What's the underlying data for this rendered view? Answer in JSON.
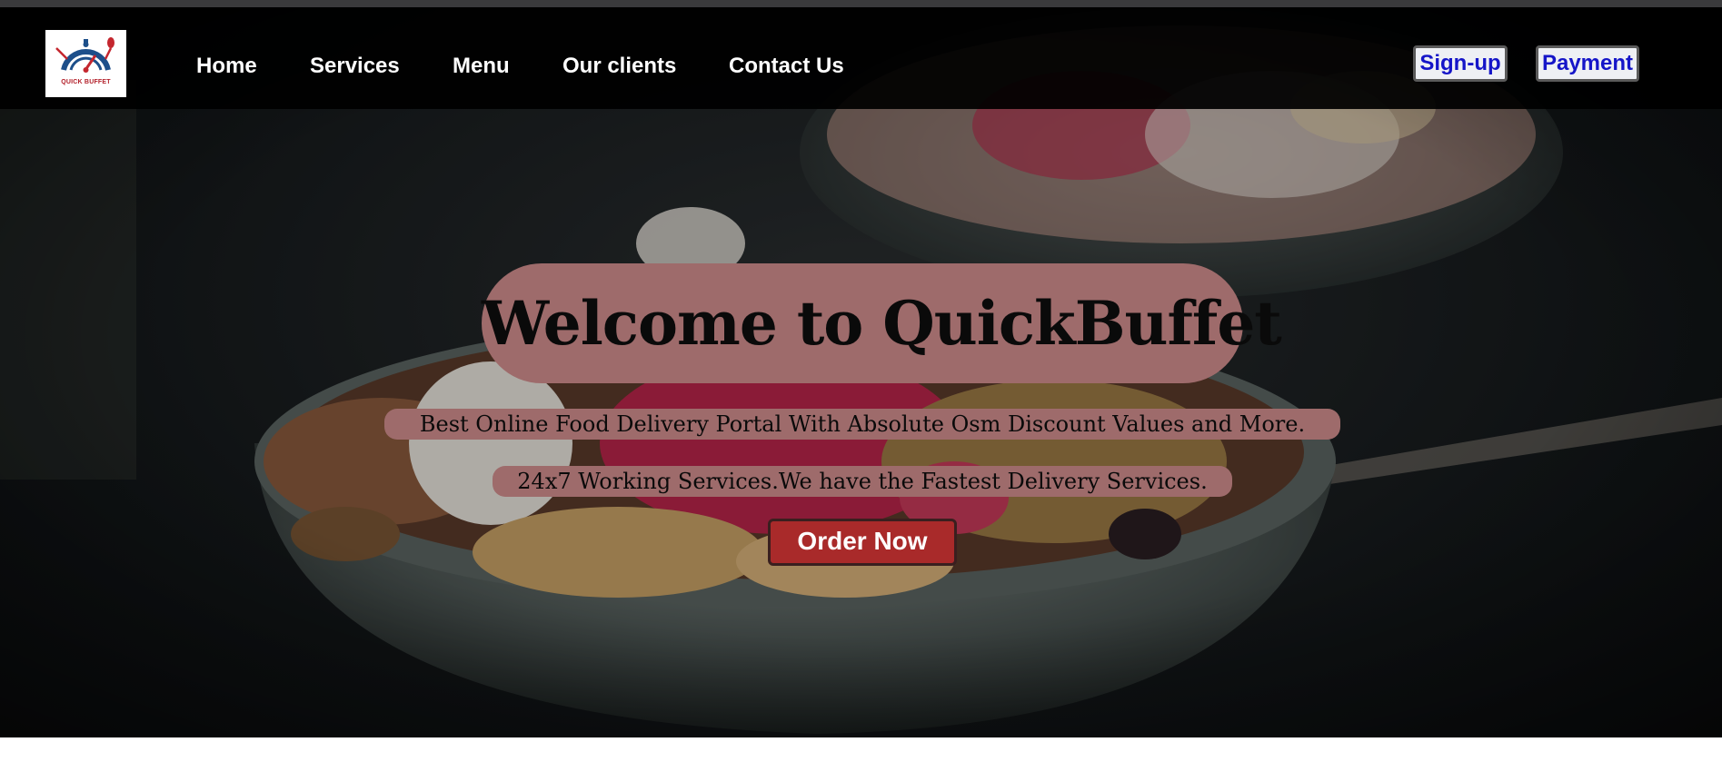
{
  "brand": {
    "logo_text": "QUICK BUFFET",
    "accent": "#a92a2a",
    "pill_color": "#9e6b6b"
  },
  "nav": {
    "items": [
      {
        "label": "Home"
      },
      {
        "label": "Services"
      },
      {
        "label": "Menu"
      },
      {
        "label": "Our clients"
      },
      {
        "label": "Contact Us"
      }
    ],
    "signup_label": "Sign-up",
    "payment_label": "Payment"
  },
  "hero": {
    "title": "Welcome to QuickBuffet",
    "tagline_1": "Best Online Food Delivery Portal With Absolute Osm Discount Values and More.",
    "tagline_2": "24x7 Working Services.We have the Fastest Delivery Services.",
    "cta_label": "Order Now",
    "background_image": "acai-bowl-photo"
  },
  "icons": {
    "logo_icon": "chef-hat-speedometer-icon"
  }
}
